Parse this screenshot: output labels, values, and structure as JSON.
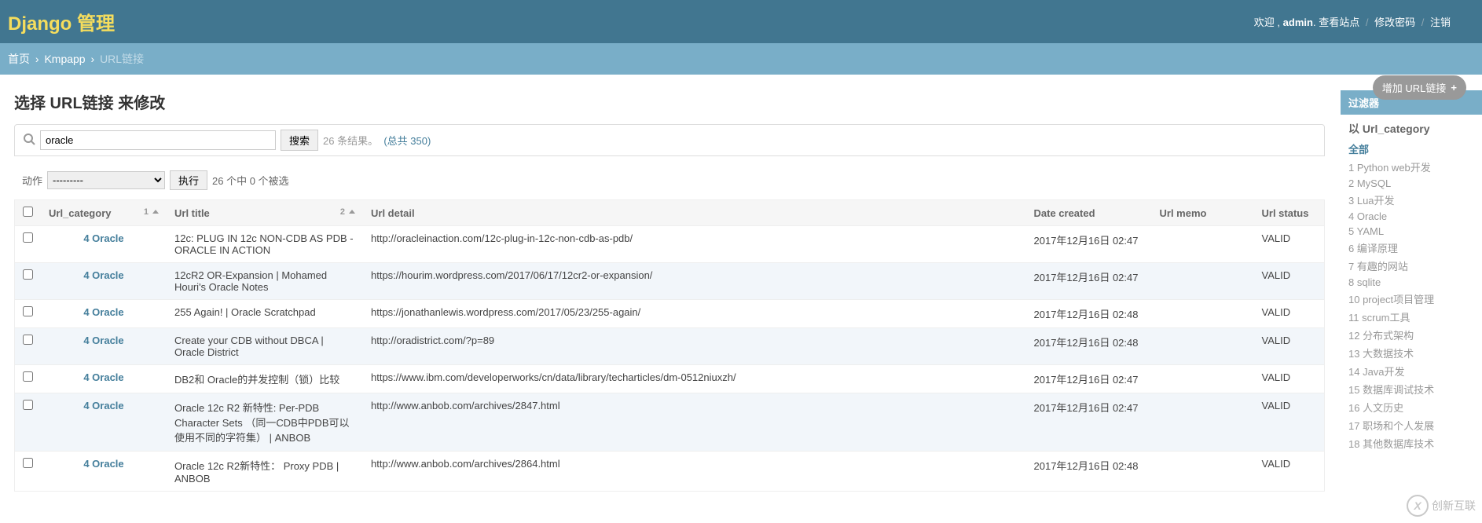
{
  "header": {
    "brand": "Django 管理",
    "welcome": "欢迎 ,",
    "username": "admin",
    "links": {
      "view_site": "查看站点",
      "change_password": "修改密码",
      "logout": "注销"
    }
  },
  "breadcrumbs": {
    "home": "首页",
    "app": "Kmpapp",
    "current": "URL链接"
  },
  "page": {
    "title": "选择 URL链接 来修改",
    "add_button": "增加 URL链接"
  },
  "toolbar": {
    "search_value": "oracle",
    "search_button": "搜索",
    "result_count": "26 条结果。",
    "total": "(总共 350)"
  },
  "actions": {
    "label": "动作",
    "placeholder": "---------",
    "go": "执行",
    "selection": "26 个中 0 个被选"
  },
  "columns": {
    "category": "Url_category",
    "title": "Url title",
    "detail": "Url detail",
    "date": "Date created",
    "memo": "Url memo",
    "status": "Url status",
    "sort1": "1",
    "sort2": "2"
  },
  "rows": [
    {
      "category": "4 Oracle",
      "title": "12c: PLUG IN 12c NON-CDB AS PDB - ORACLE IN ACTION",
      "detail": "http://oracleinaction.com/12c-plug-in-12c-non-cdb-as-pdb/",
      "date": "2017年12月16日 02:47",
      "memo": "",
      "status": "VALID"
    },
    {
      "category": "4 Oracle",
      "title": "12cR2 OR-Expansion | Mohamed Houri's Oracle Notes",
      "detail": "https://hourim.wordpress.com/2017/06/17/12cr2-or-expansion/",
      "date": "2017年12月16日 02:47",
      "memo": "",
      "status": "VALID"
    },
    {
      "category": "4 Oracle",
      "title": "255 Again! | Oracle Scratchpad",
      "detail": "https://jonathanlewis.wordpress.com/2017/05/23/255-again/",
      "date": "2017年12月16日 02:48",
      "memo": "",
      "status": "VALID"
    },
    {
      "category": "4 Oracle",
      "title": "Create your CDB without DBCA | Oracle District",
      "detail": "http://oradistrict.com/?p=89",
      "date": "2017年12月16日 02:48",
      "memo": "",
      "status": "VALID"
    },
    {
      "category": "4 Oracle",
      "title": "DB2和 Oracle的并发控制（锁）比较",
      "detail": "https://www.ibm.com/developerworks/cn/data/library/techarticles/dm-0512niuxzh/",
      "date": "2017年12月16日 02:47",
      "memo": "",
      "status": "VALID"
    },
    {
      "category": "4 Oracle",
      "title": "Oracle 12c R2 新特性: Per-PDB Character Sets （同一CDB中PDB可以使用不同的字符集） | ANBOB",
      "detail": "http://www.anbob.com/archives/2847.html",
      "date": "2017年12月16日 02:47",
      "memo": "",
      "status": "VALID"
    },
    {
      "category": "4 Oracle",
      "title": "Oracle 12c R2新特性： Proxy PDB | ANBOB",
      "detail": "http://www.anbob.com/archives/2864.html",
      "date": "2017年12月16日 02:48",
      "memo": "",
      "status": "VALID"
    }
  ],
  "filter": {
    "title": "过滤器",
    "by_label": "以 Url_category",
    "all": "全部",
    "items": [
      "1 Python web开发",
      "2 MySQL",
      "3 Lua开发",
      "4 Oracle",
      "5 YAML",
      "6 编译原理",
      "7 有趣的网站",
      "8 sqlite",
      "10 project项目管理",
      "11 scrum工具",
      "12 分布式架构",
      "13 大数据技术",
      "14 Java开发",
      "15 数据库调试技术",
      "16 人文历史",
      "17 职场和个人发展",
      "18 其他数据库技术"
    ]
  },
  "watermark": {
    "text": "创新互联",
    "icon": "X"
  }
}
